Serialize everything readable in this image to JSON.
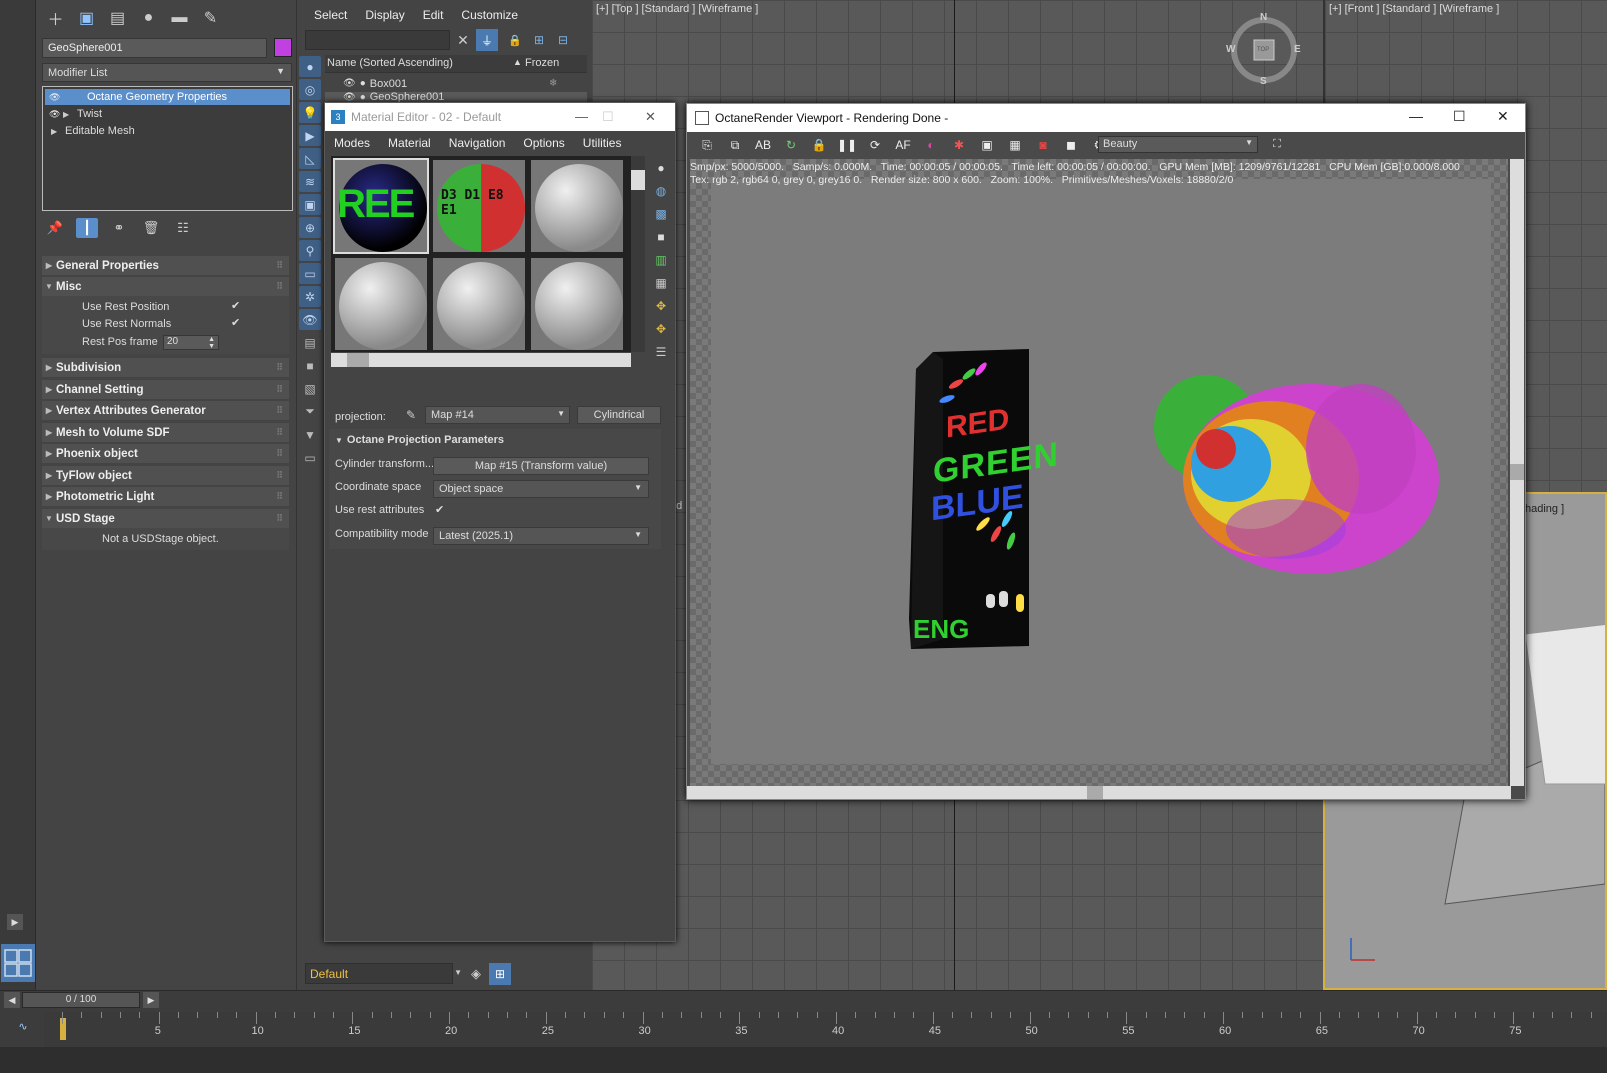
{
  "command_panel": {
    "object_name": "GeoSphere001",
    "object_color": "#c040e0",
    "modifier_list": "Modifier List",
    "stack": [
      "Octane Geometry Properties",
      "Twist",
      "Editable Mesh"
    ],
    "rollouts": {
      "general": "General Properties",
      "misc": "Misc",
      "use_rest_position": "Use Rest Position",
      "use_rest_normals": "Use Rest Normals",
      "rest_pos_frame": "Rest Pos frame",
      "rest_pos_frame_value": "20",
      "subdivision": "Subdivision",
      "channel_setting": "Channel Setting",
      "vertex_attr": "Vertex Attributes Generator",
      "mesh_to_volume": "Mesh to Volume SDF",
      "phoenix": "Phoenix object",
      "tyflow": "TyFlow object",
      "photometric": "Photometric Light",
      "usd_stage": "USD Stage",
      "usd_note": "Not a USDStage object."
    }
  },
  "scene_explorer": {
    "menu": [
      "Select",
      "Display",
      "Edit",
      "Customize"
    ],
    "col_name": "Name (Sorted Ascending)",
    "col_frozen": "Frozen",
    "rows": [
      "Box001",
      "GeoSphere001"
    ],
    "layer": "Default"
  },
  "viewports": {
    "top_label": "[+] [Top ] [Standard ] [Wireframe ]",
    "front_label": "[+] [Front ] [Standard ] [Wireframe ]",
    "compass": {
      "n": "N",
      "s": "S",
      "e": "E",
      "w": "W",
      "top": "TOP"
    },
    "persp_partial": "hading ]",
    "left_partial": "nd"
  },
  "material_editor": {
    "title": "Material Editor - 02 - Default",
    "menu": [
      "Modes",
      "Material",
      "Navigation",
      "Options",
      "Utilities"
    ],
    "projection_label": "projection:",
    "projection_map": "Map #14",
    "projection_type": "Cylindrical",
    "section": "Octane Projection Parameters",
    "cylinder_transform_label": "Cylinder transform...",
    "cylinder_transform_value": "Map #15 (Transform value)",
    "coord_space_label": "Coordinate space",
    "coord_space_value": "Object space",
    "use_rest_label": "Use rest attributes",
    "compat_label": "Compatibility mode",
    "compat_value": "Latest (2025.1)",
    "swatch1_text": "REE",
    "swatch2_text": "D3 D1 E8 E1"
  },
  "octane": {
    "title": "OctaneRender Viewport - Rendering Done -",
    "pass": "Beauty",
    "stats_line1": "Smp/px: 5000/5000.   Samp/s: 0.000M.   Time: 00:00:05 / 00:00:05.   Time left: 00:00:05 / 00:00:00.   GPU Mem [MB]: 1209/9761/12281   CPU Mem [GB]:0.000/8.000",
    "stats_line2": "Tex: rgb 2, rgb64 0, grey 0, grey16 0.   Render size: 800 x 600.   Zoom: 100%.   Primitives/Meshes/Voxels: 18880/2/0",
    "box_texts": [
      "RED",
      "GREEN",
      "BLUE",
      "ENG"
    ]
  },
  "timeline": {
    "slider": "0 / 100",
    "labels": [
      "5",
      "10",
      "15",
      "20",
      "25",
      "30",
      "35",
      "40",
      "45",
      "50",
      "55",
      "60",
      "65",
      "70",
      "75"
    ]
  }
}
